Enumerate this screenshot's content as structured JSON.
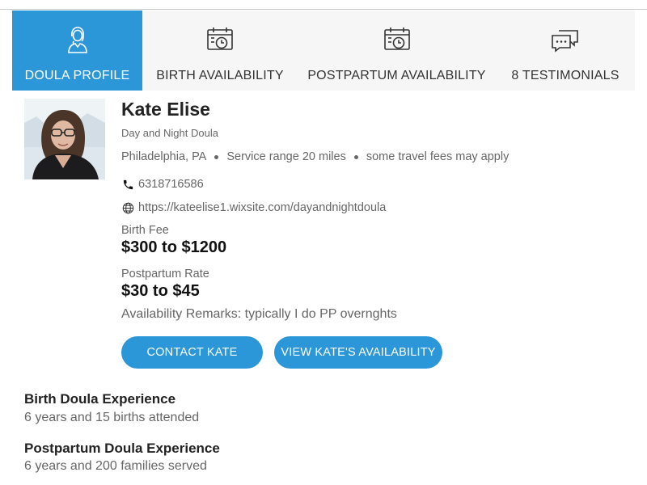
{
  "tabs": [
    {
      "label": "DOULA PROFILE",
      "icon": "doula-person-icon",
      "active": true
    },
    {
      "label": "BIRTH AVAILABILITY",
      "icon": "calendar-clock-icon",
      "active": false
    },
    {
      "label": "POSTPARTUM AVAILABILITY",
      "icon": "calendar-clock-icon",
      "active": false
    },
    {
      "label": "8 TESTIMONIALS",
      "icon": "chat-bubbles-icon",
      "active": false
    }
  ],
  "profile": {
    "name": "Kate Elise",
    "subtitle": "Day and Night Doula",
    "city": "Philadelphia, PA",
    "service_range": "Service range 20 miles",
    "travel_note": "some travel fees may apply",
    "phone": "6318716586",
    "website": "https://kateelise1.wixsite.com/dayandnightdoula",
    "birth_fee_label": "Birth Fee",
    "birth_fee": "$300 to $1200",
    "postpartum_rate_label": "Postpartum Rate",
    "postpartum_rate": "$30 to $45",
    "remarks": "Availability Remarks: typically I do PP overnghts"
  },
  "buttons": {
    "contact": "CONTACT KATE",
    "availability": "VIEW KATE'S AVAILABILITY"
  },
  "experience": {
    "birth_title": "Birth Doula Experience",
    "birth_value": "6 years and 15 births attended",
    "postpartum_title": "Postpartum Doula Experience",
    "postpartum_value": "6 years and 200 families served"
  },
  "colors": {
    "accent": "#2b97d9",
    "tab_bar": "#f6f6f6",
    "muted_text": "#666666"
  }
}
